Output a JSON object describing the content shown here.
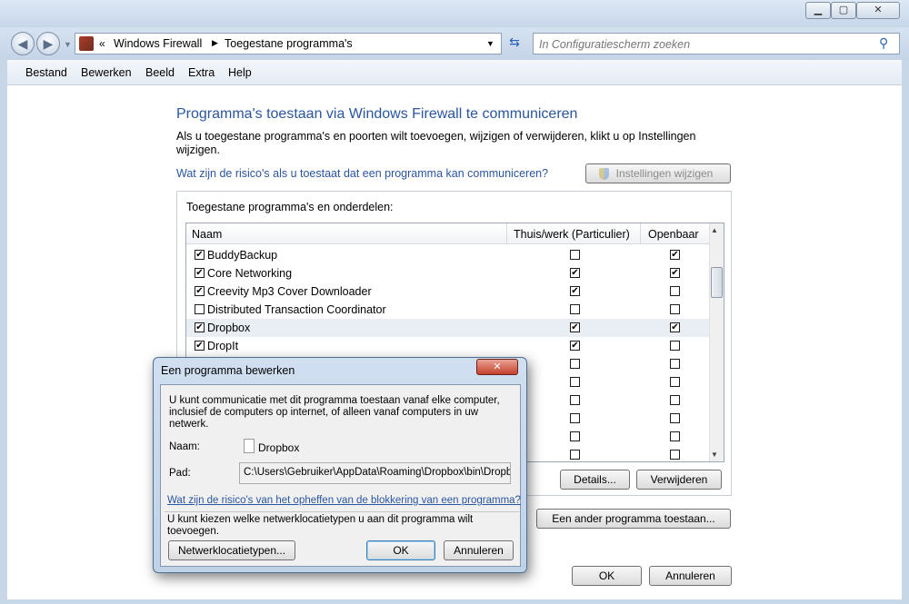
{
  "address": {
    "breadcrumb_prefix": "«",
    "crumb1": "Windows Firewall",
    "crumb2": "Toegestane programma's"
  },
  "search": {
    "placeholder": "In Configuratiescherm zoeken"
  },
  "menu": [
    "Bestand",
    "Bewerken",
    "Beeld",
    "Extra",
    "Help"
  ],
  "main": {
    "title": "Programma's toestaan via Windows Firewall te communiceren",
    "description": "Als u toegestane programma's en poorten wilt toevoegen, wijzigen of verwijderen, klikt u op Instellingen wijzigen.",
    "risk_link": "Wat zijn de risico's als u toestaat dat een programma kan communiceren?",
    "settings_button": "Instellingen wijzigen",
    "group_label": "Toegestane programma's en onderdelen:",
    "columns": [
      "Naam",
      "Thuis/werk (Particulier)",
      "Openbaar"
    ],
    "rows": [
      {
        "name": "BuddyBackup",
        "enabled": true,
        "private": false,
        "public": true
      },
      {
        "name": "Core Networking",
        "enabled": true,
        "private": true,
        "public": true
      },
      {
        "name": "Creevity Mp3 Cover Downloader",
        "enabled": true,
        "private": true,
        "public": false
      },
      {
        "name": "Distributed Transaction Coordinator",
        "enabled": false,
        "private": false,
        "public": false
      },
      {
        "name": "Dropbox",
        "enabled": true,
        "private": true,
        "public": true
      },
      {
        "name": "DropIt",
        "enabled": true,
        "private": true,
        "public": false
      },
      {
        "name": "",
        "enabled": false,
        "private": false,
        "public": false
      },
      {
        "name": "",
        "enabled": false,
        "private": false,
        "public": false
      },
      {
        "name": "",
        "enabled": false,
        "private": false,
        "public": false
      },
      {
        "name": "",
        "enabled": false,
        "private": false,
        "public": false
      },
      {
        "name": "",
        "enabled": false,
        "private": false,
        "public": false
      },
      {
        "name": "",
        "enabled": false,
        "private": false,
        "public": false
      }
    ],
    "details_button": "Details...",
    "remove_button": "Verwijderen",
    "add_button": "Een ander programma toestaan...",
    "ok_button": "OK",
    "cancel_button": "Annuleren"
  },
  "dialog": {
    "title": "Een programma bewerken",
    "intro": "U kunt communicatie met dit programma toestaan vanaf elke computer, inclusief de computers op internet, of alleen vanaf computers in uw netwerk.",
    "name_label": "Naam:",
    "name_value": "Dropbox",
    "path_label": "Pad:",
    "path_value": "C:\\Users\\Gebruiker\\AppData\\Roaming\\Dropbox\\bin\\Dropbox.exe",
    "risk_link": "Wat zijn de risico's van het opheffen van de blokkering van een programma?",
    "network_text": "U kunt kiezen welke netwerklocatietypen u aan dit programma wilt toevoegen.",
    "network_button": "Netwerklocatietypen...",
    "ok_button": "OK",
    "cancel_button": "Annuleren",
    "close_glyph": "✕"
  },
  "captions": {
    "minimize": "▁",
    "maximize": "▢",
    "close": "✕"
  }
}
